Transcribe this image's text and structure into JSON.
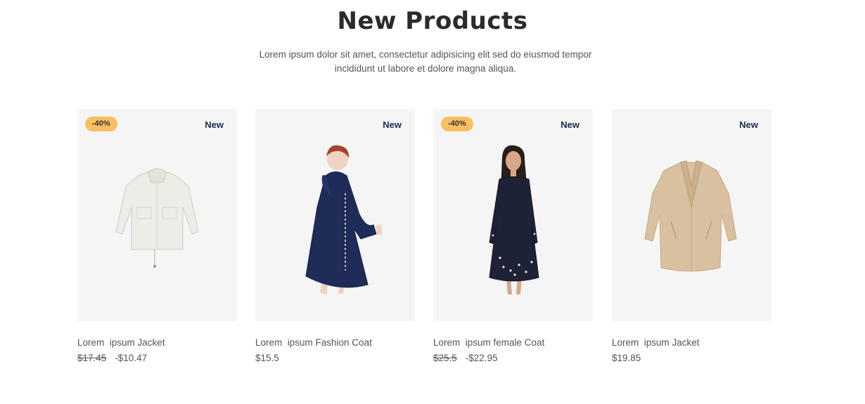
{
  "section": {
    "title": "New Products",
    "description": "Lorem ipsum dolor sit amet, consectetur adipisicing elit sed do eiusmod tempor incididunt ut labore et dolore magna aliqua."
  },
  "products": [
    {
      "name": "Lorem  ipsum Jacket",
      "badge_sale": "-40%",
      "badge_new": "New",
      "old_price": "$17.45",
      "price": "-$10.47",
      "image": "white-jacket"
    },
    {
      "name": "Lorem  ipsum Fashion Coat",
      "badge_new": "New",
      "price": "$15.5",
      "image": "denim-coat"
    },
    {
      "name": "Lorem  ipsum female Coat",
      "badge_sale": "-40%",
      "badge_new": "New",
      "old_price": "$25.5",
      "price": "-$22.95",
      "image": "black-dress"
    },
    {
      "name": "Lorem  ipsum Jacket",
      "badge_new": "New",
      "price": "$19.85",
      "image": "teddy-coat"
    }
  ],
  "colors": {
    "sale_badge": "#f9bf62",
    "new_badge_text": "#1d2b4f",
    "card_bg": "#f5f5f5"
  }
}
